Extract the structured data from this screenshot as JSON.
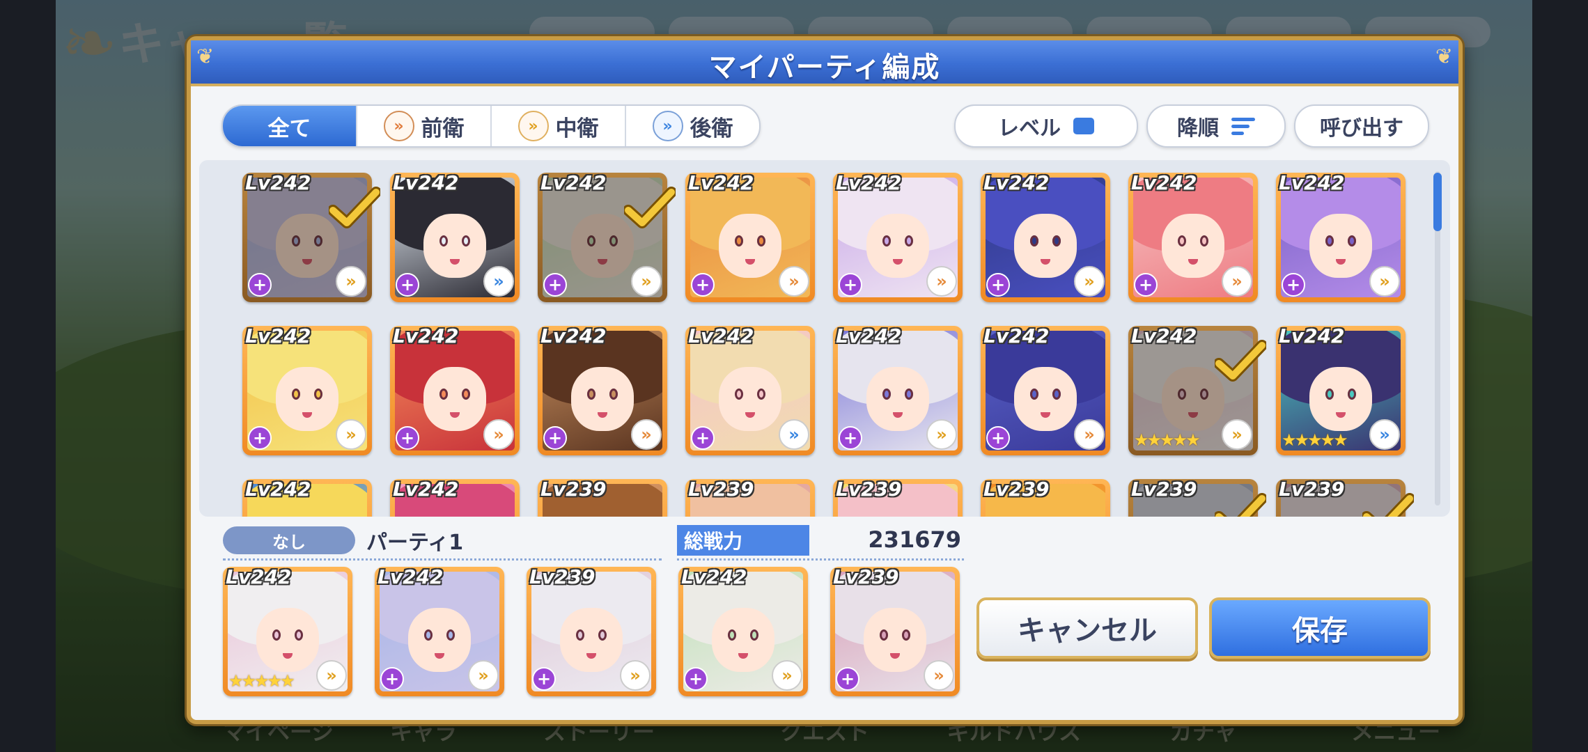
{
  "background": {
    "title_partial": "キャ　一覧",
    "bottom_menu": [
      "マイページ",
      "キャラ",
      "ストーリー",
      "クエスト",
      "ギルドハウス",
      "ガチャ",
      "メニュー"
    ]
  },
  "dialog": {
    "title": "マイパーティ編成",
    "filter_tabs": [
      {
        "label": "全て",
        "active": true,
        "icon": null
      },
      {
        "label": "前衛",
        "active": false,
        "icon": "double-chevron-orange-icon"
      },
      {
        "label": "中衛",
        "active": false,
        "icon": "double-chevron-orange-icon"
      },
      {
        "label": "後衛",
        "active": false,
        "icon": "double-chevron-blue-icon"
      }
    ],
    "sort_field": "レベル",
    "sort_order": "降順",
    "recall_label": "呼び出す",
    "roster": [
      {
        "level": "Lv242",
        "selected": true,
        "position": "mid",
        "badge": "plus",
        "palette": [
          "#c9c4e8",
          "#a7b6e8"
        ]
      },
      {
        "level": "Lv242",
        "selected": false,
        "position": "rear",
        "badge": "plus",
        "palette": [
          "#2b2a33",
          "#e6eef6"
        ]
      },
      {
        "level": "Lv242",
        "selected": true,
        "position": "mid",
        "badge": "plus",
        "palette": [
          "#ecebe6",
          "#bfe0b8"
        ]
      },
      {
        "level": "Lv242",
        "selected": false,
        "position": "front",
        "badge": "plus",
        "palette": [
          "#f2b857",
          "#e98a40"
        ]
      },
      {
        "level": "Lv242",
        "selected": false,
        "position": "front",
        "badge": "plus",
        "palette": [
          "#efe4f2",
          "#c8a8e8"
        ]
      },
      {
        "level": "Lv242",
        "selected": false,
        "position": "mid",
        "badge": "plus",
        "palette": [
          "#4a4fc0",
          "#2e3a86"
        ]
      },
      {
        "level": "Lv242",
        "selected": false,
        "position": "front",
        "badge": "plus",
        "palette": [
          "#ee7c83",
          "#f6c2c2"
        ]
      },
      {
        "level": "Lv242",
        "selected": false,
        "position": "mid",
        "badge": "plus",
        "palette": [
          "#b48ce8",
          "#7a62c8"
        ]
      },
      {
        "level": "Lv242",
        "selected": false,
        "position": "mid",
        "badge": "plus",
        "palette": [
          "#f6e27a",
          "#f2c24a"
        ]
      },
      {
        "level": "Lv242",
        "selected": false,
        "position": "front",
        "badge": "plus",
        "palette": [
          "#c8323a",
          "#f48b5a"
        ]
      },
      {
        "level": "Lv242",
        "selected": false,
        "position": "front",
        "badge": "plus",
        "palette": [
          "#5a3420",
          "#c89060"
        ]
      },
      {
        "level": "Lv242",
        "selected": false,
        "position": "rear",
        "badge": "plus",
        "palette": [
          "#f2dcb0",
          "#f4c4c8"
        ]
      },
      {
        "level": "Lv242",
        "selected": false,
        "position": "mid",
        "badge": "plus",
        "palette": [
          "#e6e4ee",
          "#7c78d8"
        ]
      },
      {
        "level": "Lv242",
        "selected": false,
        "position": "front",
        "badge": "plus",
        "palette": [
          "#3a3a9a",
          "#5a62c8"
        ]
      },
      {
        "level": "Lv242",
        "selected": true,
        "position": "mid",
        "badge": "stars",
        "stars": 5,
        "palette": [
          "#f0eef0",
          "#eac4d8"
        ]
      },
      {
        "level": "Lv242",
        "selected": false,
        "position": "rear",
        "badge": "stars",
        "stars": 5,
        "palette": [
          "#3a3270",
          "#4ac8c0"
        ]
      },
      {
        "level": "Lv242",
        "selected": false,
        "position": "mid",
        "badge": "plus",
        "palette": [
          "#f6d85a",
          "#4a8ad8"
        ]
      },
      {
        "level": "Lv242",
        "selected": false,
        "position": "mid",
        "badge": "plus",
        "palette": [
          "#d84a7a",
          "#f4a0c0"
        ]
      },
      {
        "level": "Lv239",
        "selected": false,
        "position": "mid",
        "badge": "plus",
        "palette": [
          "#a06030",
          "#e0a070"
        ]
      },
      {
        "level": "Lv239",
        "selected": false,
        "position": "mid",
        "badge": "plus",
        "palette": [
          "#f0c0a0",
          "#e0a0a0"
        ]
      },
      {
        "level": "Lv239",
        "selected": false,
        "position": "mid",
        "badge": "plus",
        "palette": [
          "#f4c0c8",
          "#f6e06a"
        ]
      },
      {
        "level": "Lv239",
        "selected": false,
        "position": "mid",
        "badge": "plus",
        "palette": [
          "#f6b84a",
          "#f08a24"
        ]
      },
      {
        "level": "Lv239",
        "selected": true,
        "position": "mid",
        "badge": "plus",
        "palette": [
          "#d0d8e8",
          "#a0b0d0"
        ]
      },
      {
        "level": "Lv239",
        "selected": true,
        "position": "mid",
        "badge": "plus",
        "palette": [
          "#e8e0e8",
          "#d8a0b8"
        ]
      }
    ],
    "party": {
      "tag": "なし",
      "name": "パーティ1",
      "power_label": "総戦力",
      "power_value": "231679",
      "members": [
        {
          "level": "Lv242",
          "position": "mid",
          "badge": "stars",
          "stars": 5,
          "palette": [
            "#f0eef0",
            "#eac4d8"
          ]
        },
        {
          "level": "Lv242",
          "position": "mid",
          "badge": "plus",
          "palette": [
            "#c9c4e8",
            "#a7b6e8"
          ]
        },
        {
          "level": "Lv239",
          "position": "mid",
          "badge": "plus",
          "palette": [
            "#eceaf0",
            "#e0c8d8"
          ]
        },
        {
          "level": "Lv242",
          "position": "mid",
          "badge": "plus",
          "palette": [
            "#ecebe6",
            "#bfe0b8"
          ]
        },
        {
          "level": "Lv239",
          "position": "front",
          "badge": "plus",
          "palette": [
            "#e8e0e8",
            "#d8a0b8"
          ]
        }
      ]
    },
    "buttons": {
      "cancel": "キャンセル",
      "save": "保存"
    }
  },
  "colors": {
    "header_blue": "#3b6fd4",
    "frame_gold": "#c79b45",
    "card_orange": "#f08a24",
    "save_blue": "#2f6fe0",
    "check_yellow": "#f3c83a"
  }
}
